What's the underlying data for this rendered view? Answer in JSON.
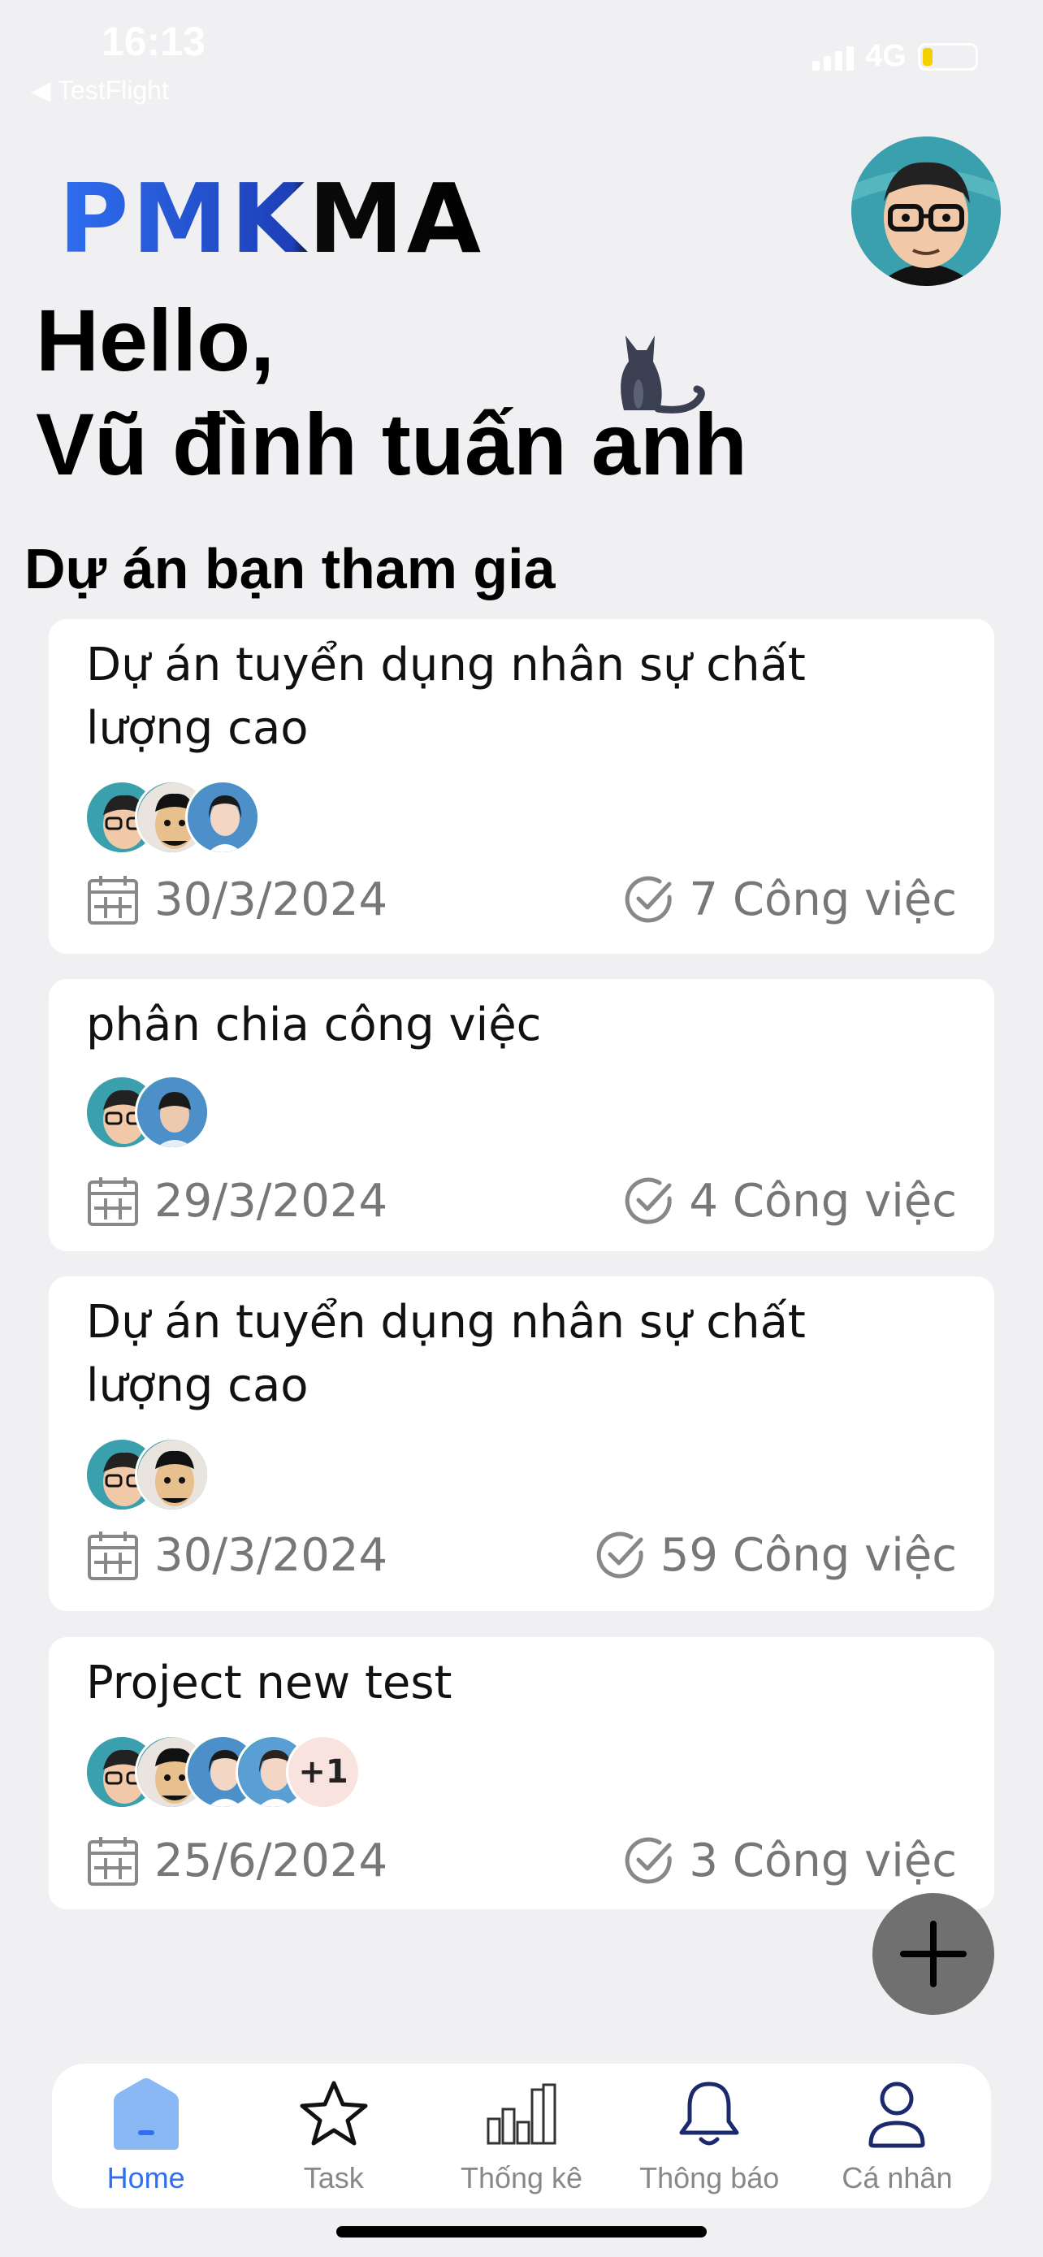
{
  "status_bar": {
    "time": "16:13",
    "back_label": "◀ TestFlight",
    "network": "4G",
    "battery_level": 0.2
  },
  "header": {
    "logo": "PMKMA",
    "greeting_line1": "Hello,",
    "greeting_line2": "Vũ đình tuấn anh"
  },
  "section": {
    "title": "Dự án bạn tham gia"
  },
  "projects": [
    {
      "title": "Dự án tuyển dụng nhân sự chất lượng cao",
      "date": "30/3/2024",
      "tasks": "7 Công việc",
      "members": 3,
      "extra_members": ""
    },
    {
      "title": "phân chia công việc",
      "date": "29/3/2024",
      "tasks": "4 Công việc",
      "members": 2,
      "extra_members": ""
    },
    {
      "title": "Dự án tuyển dụng nhân sự chất lượng cao",
      "date": "30/3/2024",
      "tasks": "59 Công việc",
      "members": 2,
      "extra_members": ""
    },
    {
      "title": "Project new test",
      "date": "25/6/2024",
      "tasks": "3 Công việc",
      "members": 4,
      "extra_members": "+1"
    }
  ],
  "fab": {
    "icon": "plus-icon"
  },
  "tabbar": {
    "tabs": [
      {
        "label": "Home",
        "icon": "home-icon",
        "active": true
      },
      {
        "label": "Task",
        "icon": "star-icon",
        "active": false
      },
      {
        "label": "Thống kê",
        "icon": "bar-chart-icon",
        "active": false
      },
      {
        "label": "Thông báo",
        "icon": "bell-icon",
        "active": false
      },
      {
        "label": "Cá nhân",
        "icon": "person-icon",
        "active": false
      }
    ]
  },
  "colors": {
    "accent": "#2f6ff0",
    "background": "#f0f0f2",
    "card": "#ffffff",
    "meta_text": "#777777",
    "fab": "#707070"
  }
}
